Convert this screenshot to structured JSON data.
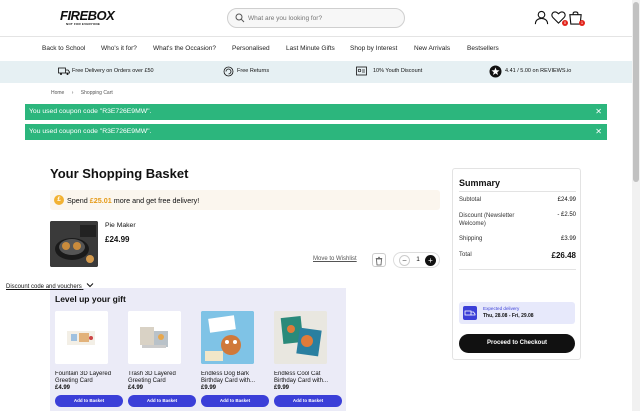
{
  "header": {
    "logo_text": "FIREBOX",
    "logo_tagline": "NOT FOR EVERYONE",
    "search_placeholder": "What are you looking for?",
    "wishlist_count": "0",
    "basket_count": "1"
  },
  "nav": [
    "Back to School",
    "Who's it for?",
    "What's the Occasion?",
    "Personalised",
    "Last Minute Gifts",
    "Shop by Interest",
    "New Arrivals",
    "Bestsellers"
  ],
  "strip": {
    "delivery": "Free Delivery on Orders over £50",
    "returns": "Free Returns",
    "youth": "10% Youth Discount",
    "reviews": "4.41 / 5.00 on REVIEWS.io"
  },
  "breadcrumb": {
    "home": "Home",
    "sep": "›",
    "current": "Shopping Cart"
  },
  "alerts": [
    "You used coupon code \"R3E726E9MW\".",
    "You used coupon code \"R3E726E9MW\"."
  ],
  "basket": {
    "title": "Your Shopping Basket",
    "free_delivery_prefix": "Spend ",
    "free_delivery_amount": "£25.01",
    "free_delivery_suffix": " more and get free delivery!",
    "item": {
      "name": "Pie Maker",
      "price": "£24.99",
      "move_to_wishlist": "Move to Wishlist",
      "quantity": "1"
    }
  },
  "gift": {
    "title": "Level up your gift",
    "cards": [
      {
        "name": "Fountain 3D Layered Greeting Card",
        "price": "£4.99",
        "button": "Add to Basket"
      },
      {
        "name": "Trash 3D Layered Greeting Card",
        "price": "£4.99",
        "button": "Add to Basket"
      },
      {
        "name": "Endless Dog Bark Birthday Card with...",
        "price": "£9.99",
        "button": "Add to Basket"
      },
      {
        "name": "Endless Cool Cat Birthday Card with...",
        "price": "£9.99",
        "button": "Add to Basket"
      }
    ]
  },
  "summary": {
    "title": "Summary",
    "subtotal_label": "Subtotal",
    "subtotal": "£24.99",
    "discount_label": "Discount (Newsletter Welcome)",
    "discount": "- £2.50",
    "shipping_label": "Shipping",
    "shipping": "£3.99",
    "total_label": "Total",
    "total": "£26.48",
    "discount_code_label": "Discount code and vouchers",
    "expected_label": "Expected delivery",
    "expected_dates": "Thu, 28.08 - Fri, 29.08",
    "checkout_label": "Proceed to Checkout"
  },
  "colors": {
    "accent": "#3b3fd8",
    "success": "#2cb67d",
    "strip_bg": "#e6f0f3",
    "promo": "#e59a17"
  }
}
